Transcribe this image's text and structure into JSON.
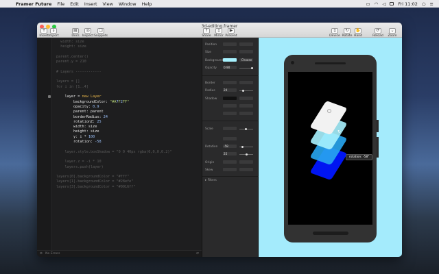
{
  "menubar": {
    "app": "Framer Future",
    "items": [
      "File",
      "Edit",
      "Insert",
      "View",
      "Window",
      "Help"
    ],
    "clock": "Fri 11:02"
  },
  "window": {
    "title": "3d-editing.framer"
  },
  "toolbar": {
    "left": [
      "Insert",
      "Import"
    ],
    "center": [
      "Docs",
      "Inspect",
      "Snippets"
    ],
    "preview": [
      "Share",
      "Mirror",
      "Present"
    ],
    "device": [
      "Device",
      "Rotate",
      "Hand"
    ],
    "right": [
      "Reload",
      "Zoom"
    ]
  },
  "code": {
    "numbers": [
      "",
      "",
      "",
      "",
      "",
      "",
      "",
      "",
      "",
      "",
      "",
      "",
      "",
      "",
      "",
      "",
      "",
      "",
      "",
      "",
      "",
      "",
      "",
      "",
      "",
      "",
      "",
      "",
      "",
      "",
      "",
      "",
      "",
      "",
      "",
      "",
      "",
      "",
      "",
      "",
      "",
      "",
      ""
    ],
    "lines": [
      {
        "t": "  width: size",
        "a": false
      },
      {
        "t": "  height: size",
        "a": false
      },
      {
        "t": "",
        "a": false
      },
      {
        "t": "parent.center()",
        "a": false
      },
      {
        "t": "parent.y = 210",
        "a": false
      },
      {
        "t": "",
        "a": false
      },
      {
        "t": "# Layers ------------",
        "a": false
      },
      {
        "t": "",
        "a": false
      },
      {
        "t": "layers = []",
        "a": false
      },
      {
        "t": "for i in [1..4]",
        "a": false
      },
      {
        "t": "",
        "a": false
      },
      {
        "t": "    layer = new Layer",
        "a": true
      },
      {
        "t": "        backgroundColor: \"#A7F2FF\"",
        "a": true
      },
      {
        "t": "        opacity: 0.9",
        "a": true
      },
      {
        "t": "        parent: parent",
        "a": true
      },
      {
        "t": "        borderRadius: 24",
        "a": true
      },
      {
        "t": "        rotationZ: 25",
        "a": true
      },
      {
        "t": "        width: size",
        "a": true
      },
      {
        "t": "        height: size",
        "a": true
      },
      {
        "t": "        y: i * 100",
        "a": true
      },
      {
        "t": "        rotation: -58",
        "a": true
      },
      {
        "t": "",
        "a": false
      },
      {
        "t": "    layer.style.boxShadow = \"0 0 40px rgba(0,0,0,0.2)\"",
        "a": false
      },
      {
        "t": "",
        "a": false
      },
      {
        "t": "    layer.z = -i * 10",
        "a": false
      },
      {
        "t": "    layers.push(layer)",
        "a": false
      },
      {
        "t": "",
        "a": false
      },
      {
        "t": "layers[0].backgroundColor = \"#fff\"",
        "a": false
      },
      {
        "t": "layers[1].backgroundColor = \"#28efe\"",
        "a": false
      },
      {
        "t": "layers[3].backgroundColor = \"#0016ff\"",
        "a": false
      }
    ],
    "footer": "No Errors"
  },
  "props": {
    "labels": [
      "Position",
      "Size",
      "Background",
      "Opacity",
      "Border",
      "Radius",
      "Shadow",
      "Scale",
      "Rotation",
      "Origin",
      "Skew",
      "Filters"
    ],
    "values": {
      "opacity": "0.90",
      "radius": "24",
      "rotation": "-58",
      "rotz": "25",
      "choose": "Choose"
    }
  },
  "preview": {
    "tooltip": "rotation: -58°"
  },
  "colors": {
    "card1": "#f2f2f2",
    "card2": "#a7f2ff",
    "card3": "#28a6ef",
    "card4": "#0016ff",
    "canvas": "#a4ebfc"
  }
}
